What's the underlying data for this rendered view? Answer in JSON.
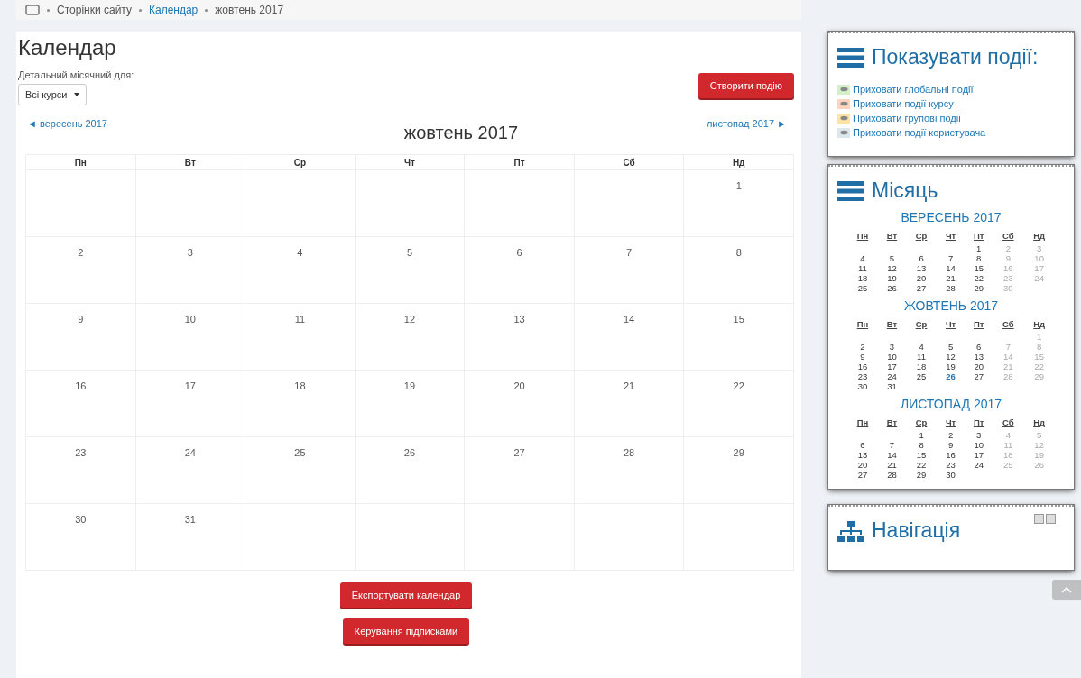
{
  "breadcrumb": [
    "Сторінки сайту",
    "Календар",
    "жовтень 2017"
  ],
  "page_title": "Календар",
  "filter": {
    "label": "Детальний місячний для:",
    "value": "Всі курси"
  },
  "new_event_button": "Створити подію",
  "nav": {
    "prev": "◄ вересень 2017",
    "current": "жовтень 2017",
    "next": "листопад 2017 ►"
  },
  "calendar": {
    "weekdays": [
      "Пн",
      "Вт",
      "Ср",
      "Чт",
      "Пт",
      "Сб",
      "Нд"
    ],
    "weeks": [
      [
        {
          "kind": "blank"
        },
        {
          "kind": "blank"
        },
        {
          "kind": "blank"
        },
        {
          "kind": "blank"
        },
        {
          "kind": "blank"
        },
        {
          "kind": "blank"
        },
        {
          "kind": "day",
          "day": "1"
        }
      ],
      [
        {
          "kind": "day",
          "day": "2"
        },
        {
          "kind": "day",
          "day": "3"
        },
        {
          "kind": "day",
          "day": "4"
        },
        {
          "kind": "day",
          "day": "5"
        },
        {
          "kind": "day",
          "day": "6"
        },
        {
          "kind": "day",
          "day": "7"
        },
        {
          "kind": "day",
          "day": "8"
        }
      ],
      [
        {
          "kind": "day",
          "day": "9"
        },
        {
          "kind": "day",
          "day": "10"
        },
        {
          "kind": "day",
          "day": "11"
        },
        {
          "kind": "day",
          "day": "12"
        },
        {
          "kind": "day",
          "day": "13"
        },
        {
          "kind": "day",
          "day": "14"
        },
        {
          "kind": "day",
          "day": "15"
        }
      ],
      [
        {
          "kind": "day",
          "day": "16"
        },
        {
          "kind": "day",
          "day": "17"
        },
        {
          "kind": "day",
          "day": "18"
        },
        {
          "kind": "day",
          "day": "19"
        },
        {
          "kind": "day",
          "day": "20"
        },
        {
          "kind": "day",
          "day": "21"
        },
        {
          "kind": "day",
          "day": "22"
        }
      ],
      [
        {
          "kind": "day",
          "day": "23"
        },
        {
          "kind": "day",
          "day": "24"
        },
        {
          "kind": "day",
          "day": "25"
        },
        {
          "kind": "day",
          "day": "26"
        },
        {
          "kind": "day",
          "day": "27"
        },
        {
          "kind": "day",
          "day": "28"
        },
        {
          "kind": "day",
          "day": "29"
        }
      ],
      [
        {
          "kind": "day",
          "day": "30"
        },
        {
          "kind": "day",
          "day": "31"
        },
        {
          "kind": "blank"
        },
        {
          "kind": "blank"
        },
        {
          "kind": "blank"
        },
        {
          "kind": "blank"
        },
        {
          "kind": "blank"
        }
      ]
    ]
  },
  "buttons": [
    "Експортувати календар",
    "Керування підписками"
  ],
  "events_block": {
    "title": "Показувати події:",
    "items": [
      {
        "label": "Приховати глобальні події",
        "color": "#d3f0c8"
      },
      {
        "label": "Приховати події курсу",
        "color": "#ffd3bd"
      },
      {
        "label": "Приховати групові події",
        "color": "#ffe3a3"
      },
      {
        "label": "Приховати події користувача",
        "color": "#dce7ec"
      }
    ]
  },
  "month_block": {
    "title": "Місяць",
    "months": [
      {
        "title": "ВЕРЕСЕНЬ 2017",
        "weekdays": [
          "Пн",
          "Вт",
          "Ср",
          "Чт",
          "Пт",
          "Сб",
          "Нд"
        ],
        "weeks": [
          [
            {
              "kind": "blank"
            },
            {
              "kind": "blank"
            },
            {
              "kind": "blank"
            },
            {
              "kind": "blank"
            },
            {
              "kind": "day",
              "day": "1",
              "today": false
            },
            {
              "kind": "day",
              "day": "2",
              "today": false
            },
            {
              "kind": "day",
              "day": "3",
              "today": false
            }
          ],
          [
            {
              "kind": "day",
              "day": "4",
              "today": false
            },
            {
              "kind": "day",
              "day": "5",
              "today": false
            },
            {
              "kind": "day",
              "day": "6",
              "today": false
            },
            {
              "kind": "day",
              "day": "7",
              "today": false
            },
            {
              "kind": "day",
              "day": "8",
              "today": false
            },
            {
              "kind": "day",
              "day": "9",
              "today": false
            },
            {
              "kind": "day",
              "day": "10",
              "today": false
            }
          ],
          [
            {
              "kind": "day",
              "day": "11",
              "today": false
            },
            {
              "kind": "day",
              "day": "12",
              "today": false
            },
            {
              "kind": "day",
              "day": "13",
              "today": false
            },
            {
              "kind": "day",
              "day": "14",
              "today": false
            },
            {
              "kind": "day",
              "day": "15",
              "today": false
            },
            {
              "kind": "day",
              "day": "16",
              "today": false
            },
            {
              "kind": "day",
              "day": "17",
              "today": false
            }
          ],
          [
            {
              "kind": "day",
              "day": "18",
              "today": false
            },
            {
              "kind": "day",
              "day": "19",
              "today": false
            },
            {
              "kind": "day",
              "day": "20",
              "today": false
            },
            {
              "kind": "day",
              "day": "21",
              "today": false
            },
            {
              "kind": "day",
              "day": "22",
              "today": false
            },
            {
              "kind": "day",
              "day": "23",
              "today": false
            },
            {
              "kind": "day",
              "day": "24",
              "today": false
            }
          ],
          [
            {
              "kind": "day",
              "day": "25",
              "today": false
            },
            {
              "kind": "day",
              "day": "26",
              "today": false
            },
            {
              "kind": "day",
              "day": "27",
              "today": false
            },
            {
              "kind": "day",
              "day": "28",
              "today": false
            },
            {
              "kind": "day",
              "day": "29",
              "today": false
            },
            {
              "kind": "day",
              "day": "30",
              "today": false
            },
            {
              "kind": "blank"
            }
          ]
        ]
      },
      {
        "title": "ЖОВТЕНЬ 2017",
        "weekdays": [
          "Пн",
          "Вт",
          "Ср",
          "Чт",
          "Пт",
          "Сб",
          "Нд"
        ],
        "weeks": [
          [
            {
              "kind": "blank"
            },
            {
              "kind": "blank"
            },
            {
              "kind": "blank"
            },
            {
              "kind": "blank"
            },
            {
              "kind": "blank"
            },
            {
              "kind": "blank"
            },
            {
              "kind": "day",
              "day": "1",
              "today": false
            }
          ],
          [
            {
              "kind": "day",
              "day": "2",
              "today": false
            },
            {
              "kind": "day",
              "day": "3",
              "today": false
            },
            {
              "kind": "day",
              "day": "4",
              "today": false
            },
            {
              "kind": "day",
              "day": "5",
              "today": false
            },
            {
              "kind": "day",
              "day": "6",
              "today": false
            },
            {
              "kind": "day",
              "day": "7",
              "today": false
            },
            {
              "kind": "day",
              "day": "8",
              "today": false
            }
          ],
          [
            {
              "kind": "day",
              "day": "9",
              "today": false
            },
            {
              "kind": "day",
              "day": "10",
              "today": false
            },
            {
              "kind": "day",
              "day": "11",
              "today": false
            },
            {
              "kind": "day",
              "day": "12",
              "today": false
            },
            {
              "kind": "day",
              "day": "13",
              "today": false
            },
            {
              "kind": "day",
              "day": "14",
              "today": false
            },
            {
              "kind": "day",
              "day": "15",
              "today": false
            }
          ],
          [
            {
              "kind": "day",
              "day": "16",
              "today": false
            },
            {
              "kind": "day",
              "day": "17",
              "today": false
            },
            {
              "kind": "day",
              "day": "18",
              "today": false
            },
            {
              "kind": "day",
              "day": "19",
              "today": false
            },
            {
              "kind": "day",
              "day": "20",
              "today": false
            },
            {
              "kind": "day",
              "day": "21",
              "today": false
            },
            {
              "kind": "day",
              "day": "22",
              "today": false
            }
          ],
          [
            {
              "kind": "day",
              "day": "23",
              "today": false
            },
            {
              "kind": "day",
              "day": "24",
              "today": false
            },
            {
              "kind": "day",
              "day": "25",
              "today": false
            },
            {
              "kind": "day",
              "day": "26",
              "today": true
            },
            {
              "kind": "day",
              "day": "27",
              "today": false
            },
            {
              "kind": "day",
              "day": "28",
              "today": false
            },
            {
              "kind": "day",
              "day": "29",
              "today": false
            }
          ],
          [
            {
              "kind": "day",
              "day": "30",
              "today": false
            },
            {
              "kind": "day",
              "day": "31",
              "today": false
            },
            {
              "kind": "blank"
            },
            {
              "kind": "blank"
            },
            {
              "kind": "blank"
            },
            {
              "kind": "blank"
            },
            {
              "kind": "blank"
            }
          ]
        ]
      },
      {
        "title": "ЛИСТОПАД 2017",
        "weekdays": [
          "Пн",
          "Вт",
          "Ср",
          "Чт",
          "Пт",
          "Сб",
          "Нд"
        ],
        "weeks": [
          [
            {
              "kind": "blank"
            },
            {
              "kind": "blank"
            },
            {
              "kind": "day",
              "day": "1",
              "today": false
            },
            {
              "kind": "day",
              "day": "2",
              "today": false
            },
            {
              "kind": "day",
              "day": "3",
              "today": false
            },
            {
              "kind": "day",
              "day": "4",
              "today": false
            },
            {
              "kind": "day",
              "day": "5",
              "today": false
            }
          ],
          [
            {
              "kind": "day",
              "day": "6",
              "today": false
            },
            {
              "kind": "day",
              "day": "7",
              "today": false
            },
            {
              "kind": "day",
              "day": "8",
              "today": false
            },
            {
              "kind": "day",
              "day": "9",
              "today": false
            },
            {
              "kind": "day",
              "day": "10",
              "today": false
            },
            {
              "kind": "day",
              "day": "11",
              "today": false
            },
            {
              "kind": "day",
              "day": "12",
              "today": false
            }
          ],
          [
            {
              "kind": "day",
              "day": "13",
              "today": false
            },
            {
              "kind": "day",
              "day": "14",
              "today": false
            },
            {
              "kind": "day",
              "day": "15",
              "today": false
            },
            {
              "kind": "day",
              "day": "16",
              "today": false
            },
            {
              "kind": "day",
              "day": "17",
              "today": false
            },
            {
              "kind": "day",
              "day": "18",
              "today": false
            },
            {
              "kind": "day",
              "day": "19",
              "today": false
            }
          ],
          [
            {
              "kind": "day",
              "day": "20",
              "today": false
            },
            {
              "kind": "day",
              "day": "21",
              "today": false
            },
            {
              "kind": "day",
              "day": "22",
              "today": false
            },
            {
              "kind": "day",
              "day": "23",
              "today": false
            },
            {
              "kind": "day",
              "day": "24",
              "today": false
            },
            {
              "kind": "day",
              "day": "25",
              "today": false
            },
            {
              "kind": "day",
              "day": "26",
              "today": false
            }
          ],
          [
            {
              "kind": "day",
              "day": "27",
              "today": false
            },
            {
              "kind": "day",
              "day": "28",
              "today": false
            },
            {
              "kind": "day",
              "day": "29",
              "today": false
            },
            {
              "kind": "day",
              "day": "30",
              "today": false
            },
            {
              "kind": "blank"
            },
            {
              "kind": "blank"
            },
            {
              "kind": "blank"
            }
          ]
        ]
      }
    ]
  },
  "navigation_block": {
    "title": "Навігація"
  }
}
